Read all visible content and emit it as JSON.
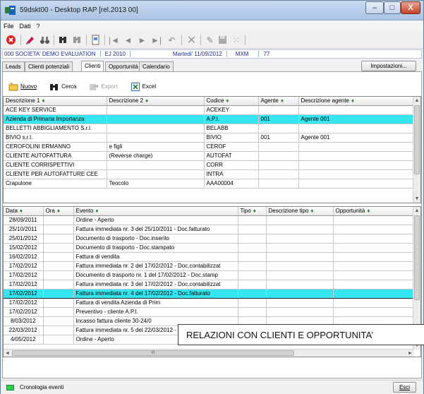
{
  "window": {
    "title": "59dskt00 - Desktop RAP  [rel.2013 00]",
    "minimize_glyph": "–",
    "maximize_glyph": "□",
    "close_glyph": "X"
  },
  "menu": [
    "File",
    "Dati",
    "?"
  ],
  "toolbar": {
    "icons": [
      "stop-icon",
      "edit-icon",
      "binoculars-icon",
      "find-icon",
      "find-next-icon",
      "document-icon",
      "first-icon",
      "prev-icon",
      "next-icon",
      "last-icon",
      "undo-icon",
      "delete-icon",
      "pencil-icon",
      "save-icon",
      "tools-icon"
    ]
  },
  "infobar": {
    "company": "000 SOCIETA'  DEMO EVALUATION",
    "year": "EJ 2010",
    "date": "Martedi' 11/09/2012",
    "user": "MXM",
    "code": "77"
  },
  "tabs": [
    {
      "label": "Leads",
      "active": false
    },
    {
      "label": "Clienti potenziali",
      "active": false
    },
    {
      "label": "Clienti",
      "active": true
    },
    {
      "label": "Opportunità",
      "active": false
    },
    {
      "label": "Calendario",
      "active": false
    }
  ],
  "settings_label": "Impostazioni...",
  "actions": {
    "new": "Nuovo",
    "search": "Cerca",
    "export": "Export",
    "excel": "Excel"
  },
  "sort_glyph": "♦",
  "clients": {
    "columns": [
      "Descrizione 1",
      "Descrizione 2",
      "Codice",
      "Agente",
      "Descrizione agente"
    ],
    "rows": [
      [
        "ACE KEY SERVICE",
        "",
        "ACEKEY",
        "",
        ""
      ],
      [
        "Azienda di Primaria Importanza",
        "",
        "A.P.I.",
        "001",
        "Agente 001"
      ],
      [
        "BELLETTI ABBIGLIAMENTO S.r.l.",
        "",
        "BELABB",
        "",
        ""
      ],
      [
        "BIVIO s.r.l.",
        "",
        "BIVIO",
        "001",
        "Agente 001"
      ],
      [
        "CEROFOLINI ERMANNO",
        "e figli",
        "CEROF",
        "",
        ""
      ],
      [
        "CLIENTE AUTOFATTURA",
        "(Reverse charge)",
        "AUTOFAT",
        "",
        ""
      ],
      [
        "CLIENTE CORRISPETTIVI",
        "",
        "CORR",
        "",
        ""
      ],
      [
        "CLIENTE PER AUTOFATTURE CEE",
        "",
        "INTRA",
        "",
        ""
      ],
      [
        "Crapulone",
        "Teocolo",
        "AAA00004",
        "",
        ""
      ]
    ],
    "selected_index": 1
  },
  "events": {
    "columns": [
      "Data",
      "Ora",
      "Evento",
      "Tipo",
      "Descrizione tipo",
      "Opportunità"
    ],
    "rows": [
      [
        "28/09/2011",
        "",
        "Ordine   - Aperto",
        "",
        "",
        ""
      ],
      [
        "25/10/2011",
        "",
        "Fattura immediata nr.      3  del 25/10/2011  - Doc.fatturato",
        "",
        "",
        ""
      ],
      [
        "25/01/2012",
        "",
        "Documento di trasporto  - Doc.inserito",
        "",
        "",
        ""
      ],
      [
        "15/02/2012",
        "",
        "Documento di trasporto  - Doc.stampato",
        "",
        "",
        ""
      ],
      [
        "16/02/2012",
        "",
        "Fattura di vendita",
        "",
        "",
        ""
      ],
      [
        "17/02/2012",
        "",
        "Fattura immediata nr.      2  del 17/02/2012  - Doc.contabilizzat",
        "",
        "",
        ""
      ],
      [
        "17/02/2012",
        "",
        "Documento di trasporto nr.     1  del 17/02/2012  - Doc.stamp",
        "",
        "",
        ""
      ],
      [
        "17/02/2012",
        "",
        "Fattura immediata nr.      3  del 17/02/2012  - Doc.contabilizzat",
        "",
        "",
        ""
      ],
      [
        "17/02/2012",
        "",
        "Fattura immediata nr.      4  del 17/02/2012  - Doc.fatturato",
        "",
        "",
        ""
      ],
      [
        "17/02/2012",
        "",
        "Fattura di vendita Azienda di Prim",
        "",
        "",
        ""
      ],
      [
        "17/02/2012",
        "",
        "Preventivo   - cliente A.P.I.",
        "",
        "",
        ""
      ],
      [
        "8/03/2012",
        "",
        "Incasso fattura cliente   30-24/0",
        "",
        "",
        ""
      ],
      [
        "22/03/2012",
        "",
        "Fattura immediata nr.      5  del 22/03/2012  - Doc.fatturato",
        "",
        "",
        ""
      ],
      [
        "4/05/2012",
        "",
        "Ordine   - Aperto",
        "",
        "",
        ""
      ]
    ],
    "selected_index": 8
  },
  "scroll_glyphs": {
    "up": "▲",
    "down": "▼",
    "left": "◄",
    "right": "►",
    "grip": "III",
    "mid": "≡"
  },
  "callout": "RELAZIONI CON CLIENTI E OPPORTUNITA’",
  "status": {
    "text": "Cronologia eventi",
    "exit_label": "Esci"
  },
  "colors": {
    "selection": "#35e5ef",
    "sort_arrow": "#2f7e35",
    "info_text": "#1f2d8a"
  }
}
